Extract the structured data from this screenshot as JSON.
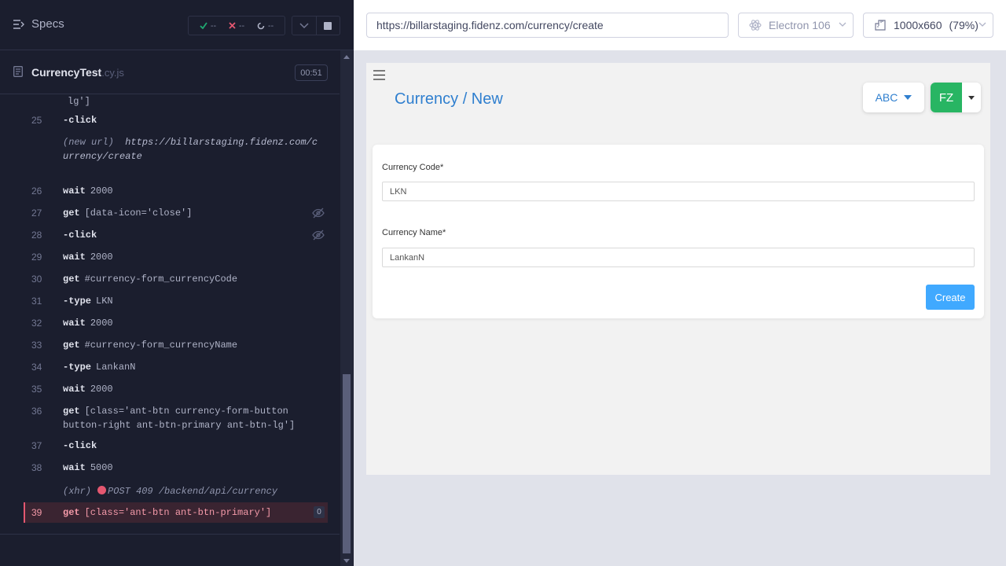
{
  "reporter": {
    "specs_label": "Specs",
    "stats": {
      "passed": "--",
      "failed": "--",
      "pending": "--"
    },
    "spec": {
      "name": "CurrencyTest",
      "ext": ".cy.js",
      "duration": "00:51"
    },
    "commands": [
      {
        "num": "",
        "name": "",
        "msg": "lg']"
      },
      {
        "num": "25",
        "name": "-click",
        "msg": ""
      },
      {
        "info_prefix": "(new url)",
        "info_url": "https://billarstaging.fidenz.com/currency/create"
      },
      {
        "num": "26",
        "name": "wait",
        "msg": "2000"
      },
      {
        "num": "27",
        "name": "get",
        "msg": "[data-icon='close']"
      },
      {
        "num": "28",
        "name": "-click",
        "msg": ""
      },
      {
        "num": "29",
        "name": "wait",
        "msg": "2000"
      },
      {
        "num": "30",
        "name": "get",
        "msg": "#currency-form_currencyCode"
      },
      {
        "num": "31",
        "name": "-type",
        "msg": "LKN"
      },
      {
        "num": "32",
        "name": "wait",
        "msg": "2000"
      },
      {
        "num": "33",
        "name": "get",
        "msg": "#currency-form_currencyName"
      },
      {
        "num": "34",
        "name": "-type",
        "msg": "LankanN"
      },
      {
        "num": "35",
        "name": "wait",
        "msg": "2000"
      },
      {
        "num": "36",
        "name": "get",
        "msg": "[class='ant-btn currency-form-button button-right ant-btn-primary ant-btn-lg']"
      },
      {
        "num": "37",
        "name": "-click",
        "msg": ""
      },
      {
        "num": "38",
        "name": "wait",
        "msg": "5000"
      },
      {
        "xhr_prefix": "(xhr)",
        "xhr_text": "POST 409 /backend/api/currency"
      },
      {
        "num": "39",
        "name": "get",
        "msg": "[class='ant-btn ant-btn-primary']",
        "badge": "0"
      }
    ]
  },
  "aut": {
    "url": "https://billarstaging.fidenz.com/currency/create",
    "browser": "Electron 106",
    "viewport": "1000x660",
    "scale": "(79%)"
  },
  "app": {
    "title": "Currency / New",
    "company": "ABC",
    "user_initials": "FZ",
    "form": {
      "code_label": "Currency Code*",
      "code_value": "LKN",
      "name_label": "Currency Name*",
      "name_value": "LankanN",
      "submit_label": "Create"
    }
  }
}
